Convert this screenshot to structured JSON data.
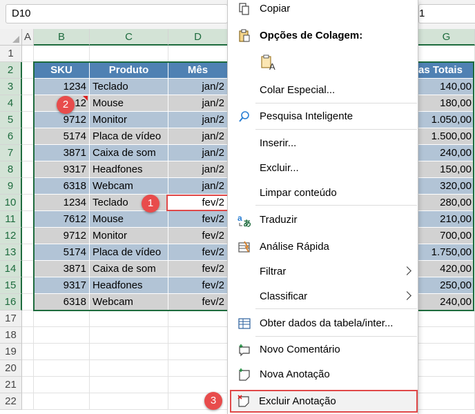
{
  "formula_bar": {
    "name_box": "D10",
    "right_fragment": "1"
  },
  "columns": [
    "A",
    "B",
    "C",
    "D",
    "G"
  ],
  "rows": [
    "1",
    "2",
    "3",
    "4",
    "5",
    "6",
    "7",
    "8",
    "9",
    "10",
    "11",
    "12",
    "13",
    "14",
    "15",
    "16",
    "17",
    "18",
    "19",
    "20",
    "21",
    "22"
  ],
  "table": {
    "headers": {
      "sku": "SKU",
      "produto": "Produto",
      "mes": "Mês",
      "totais": "as Totais"
    },
    "rows": [
      {
        "sku": "1234",
        "produto": "Teclado",
        "mes": "jan/2",
        "total": "140,00"
      },
      {
        "sku": "7612",
        "produto": "Mouse",
        "mes": "jan/2",
        "total": "180,00"
      },
      {
        "sku": "9712",
        "produto": "Monitor",
        "mes": "jan/2",
        "total": "1.050,00"
      },
      {
        "sku": "5174",
        "produto": "Placa de vídeo",
        "mes": "jan/2",
        "total": "1.500,00"
      },
      {
        "sku": "3871",
        "produto": "Caixa de som",
        "mes": "jan/2",
        "total": "240,00"
      },
      {
        "sku": "9317",
        "produto": "Headfones",
        "mes": "jan/2",
        "total": "150,00"
      },
      {
        "sku": "6318",
        "produto": "Webcam",
        "mes": "jan/2",
        "total": "320,00"
      },
      {
        "sku": "1234",
        "produto": "Teclado",
        "mes": "fev/2",
        "total": "280,00"
      },
      {
        "sku": "7612",
        "produto": "Mouse",
        "mes": "fev/2",
        "total": "210,00"
      },
      {
        "sku": "9712",
        "produto": "Monitor",
        "mes": "fev/2",
        "total": "700,00"
      },
      {
        "sku": "5174",
        "produto": "Placa de vídeo",
        "mes": "fev/2",
        "total": "1.750,00"
      },
      {
        "sku": "3871",
        "produto": "Caixa de som",
        "mes": "fev/2",
        "total": "420,00"
      },
      {
        "sku": "9317",
        "produto": "Headfones",
        "mes": "fev/2",
        "total": "250,00"
      },
      {
        "sku": "6318",
        "produto": "Webcam",
        "mes": "fev/2",
        "total": "240,00"
      }
    ],
    "sku_partial_row4": "12"
  },
  "badges": {
    "b1": "1",
    "b2": "2",
    "b3": "3"
  },
  "menu": {
    "copiar": "Copiar",
    "opcoes_colagem": "Opções de Colagem:",
    "colar_especial": "Colar Especial...",
    "pesquisa": "Pesquisa Inteligente",
    "inserir": "Inserir...",
    "excluir": "Excluir...",
    "limpar": "Limpar conteúdo",
    "traduzir": "Traduzir",
    "analise": "Análise Rápida",
    "filtrar": "Filtrar",
    "classificar": "Classificar",
    "obter": "Obter dados da tabela/inter...",
    "novo_comentario": "Novo Comentário",
    "nova_anotacao": "Nova Anotação",
    "excluir_anotacao": "Excluir Anotação"
  },
  "colors": {
    "accent_green": "#1d6b3d",
    "header_blue": "#4f81b3",
    "highlight_red": "#e04848"
  }
}
